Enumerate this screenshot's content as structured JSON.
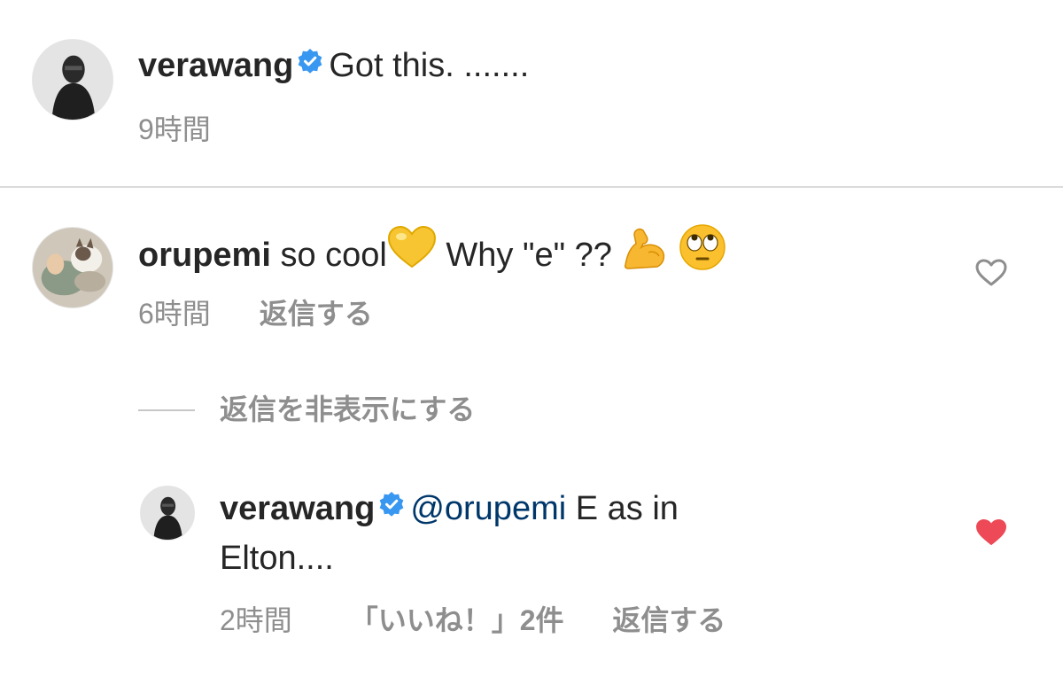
{
  "caption": {
    "username": "verawang",
    "text": "Got this. .......",
    "time": "9時間"
  },
  "comment": {
    "username": "orupemi",
    "text_before": "so cool",
    "text_after": " Why \"e\" ??",
    "time": "6時間",
    "reply_label": "返信する"
  },
  "thread": {
    "hide_replies_label": "返信を非表示にする"
  },
  "reply": {
    "username": "verawang",
    "mention": "@orupemi",
    "text_line1": " E as in",
    "text_line2": "Elton....",
    "time": "2時間",
    "likes_label": "「いいね！」2件",
    "reply_label": "返信する"
  },
  "colors": {
    "verified": "#3897f0",
    "liked_heart": "#ed4956",
    "mention": "#00376b",
    "secondary_text": "#8e8e8e"
  }
}
